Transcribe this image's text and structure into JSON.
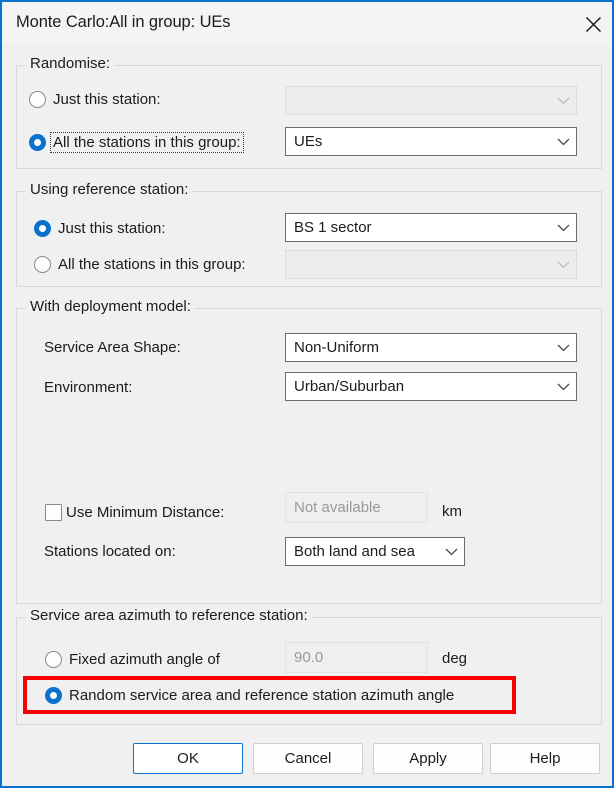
{
  "window": {
    "title": "Monte Carlo:All in group: UEs",
    "close_icon": "close-icon",
    "accent_color": "#0a72cc",
    "body_color": "#f0f0f0",
    "annotation_color": "#fb0000"
  },
  "groups": {
    "randomise": {
      "label": "Randomise:",
      "options": [
        {
          "label": "Just this station:",
          "selected": false,
          "focused": false
        },
        {
          "label": "All the stations in this group:",
          "selected": true,
          "focused": true
        }
      ],
      "combos": [
        {
          "value": "",
          "enabled": false,
          "icon": "chevron-down-icon"
        },
        {
          "value": "UEs",
          "enabled": true,
          "icon": "chevron-down-icon"
        }
      ]
    },
    "reference_station": {
      "label": "Using reference station:",
      "options": [
        {
          "label": "Just this station:",
          "selected": true,
          "focused": false
        },
        {
          "label": "All the stations in this group:",
          "selected": false,
          "focused": false
        }
      ],
      "combos": [
        {
          "value": "BS 1 sector",
          "enabled": true,
          "icon": "chevron-down-icon"
        },
        {
          "value": "",
          "enabled": false,
          "icon": "chevron-down-icon"
        }
      ]
    },
    "deployment_model": {
      "label": "With deployment model:",
      "service_area_shape": {
        "label": "Service Area Shape:",
        "value": "Non-Uniform",
        "enabled": true,
        "icon": "chevron-down-icon"
      },
      "environment": {
        "label": "Environment:",
        "value": "Urban/Suburban",
        "enabled": true,
        "icon": "chevron-down-icon"
      },
      "minimum_distance": {
        "label": "Use Minimum Distance:",
        "checked": false,
        "value": "Not available",
        "enabled": false,
        "unit": "km"
      },
      "stations_located_on": {
        "label": "Stations located on:",
        "value": "Both land and sea",
        "enabled": true,
        "icon": "chevron-down-icon"
      }
    },
    "azimuth": {
      "label": "Service area azimuth to reference station:",
      "fixed_option": {
        "label": "Fixed azimuth angle of",
        "selected": false,
        "value": "90.0",
        "enabled": false,
        "unit": "deg"
      },
      "random_option": {
        "label": "Random service area and reference station azimuth angle",
        "selected": true,
        "highlighted": true
      }
    }
  },
  "buttons": {
    "ok": "OK",
    "cancel": "Cancel",
    "apply": "Apply",
    "help": "Help"
  }
}
